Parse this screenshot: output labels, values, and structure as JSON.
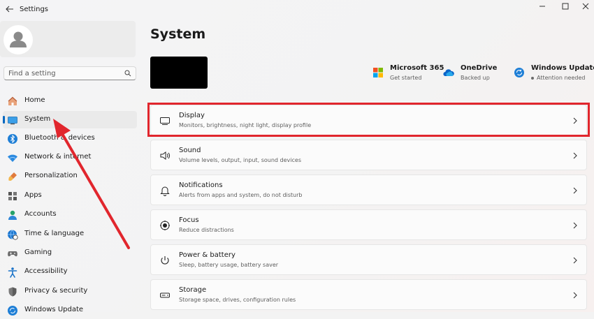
{
  "window": {
    "title": "Settings"
  },
  "sidebar": {
    "search_placeholder": "Find a setting",
    "items": [
      {
        "label": "Home",
        "icon": "home-icon"
      },
      {
        "label": "System",
        "icon": "system-icon",
        "selected": true
      },
      {
        "label": "Bluetooth & devices",
        "icon": "bluetooth-icon"
      },
      {
        "label": "Network & internet",
        "icon": "wifi-icon"
      },
      {
        "label": "Personalization",
        "icon": "paintbrush-icon"
      },
      {
        "label": "Apps",
        "icon": "apps-icon"
      },
      {
        "label": "Accounts",
        "icon": "accounts-icon"
      },
      {
        "label": "Time & language",
        "icon": "globe-clock-icon"
      },
      {
        "label": "Gaming",
        "icon": "gamepad-icon"
      },
      {
        "label": "Accessibility",
        "icon": "accessibility-icon"
      },
      {
        "label": "Privacy & security",
        "icon": "shield-icon"
      },
      {
        "label": "Windows Update",
        "icon": "windows-update-icon"
      }
    ]
  },
  "main": {
    "title": "System",
    "quick_links": [
      {
        "title": "Microsoft 365",
        "subtitle": "Get started",
        "icon": "microsoft-logo-icon"
      },
      {
        "title": "OneDrive",
        "subtitle": "Backed up",
        "icon": "onedrive-cloud-icon"
      },
      {
        "title": "Windows Update",
        "subtitle": "Attention needed",
        "icon": "windows-update-icon"
      }
    ],
    "settings": [
      {
        "title": "Display",
        "subtitle": "Monitors, brightness, night light, display profile",
        "icon": "monitor-icon"
      },
      {
        "title": "Sound",
        "subtitle": "Volume levels, output, input, sound devices",
        "icon": "speaker-icon"
      },
      {
        "title": "Notifications",
        "subtitle": "Alerts from apps and system, do not disturb",
        "icon": "bell-icon"
      },
      {
        "title": "Focus",
        "subtitle": "Reduce distractions",
        "icon": "focus-icon"
      },
      {
        "title": "Power & battery",
        "subtitle": "Sleep, battery usage, battery saver",
        "icon": "power-icon"
      },
      {
        "title": "Storage",
        "subtitle": "Storage space, drives, configuration rules",
        "icon": "storage-icon"
      }
    ]
  },
  "annotation": {
    "highlight_color": "#e1262d",
    "highlighted_item": "Display",
    "arrow_target": "System"
  },
  "colors": {
    "accent": "#0067c0",
    "attention_dot": "#6b6b6b"
  }
}
